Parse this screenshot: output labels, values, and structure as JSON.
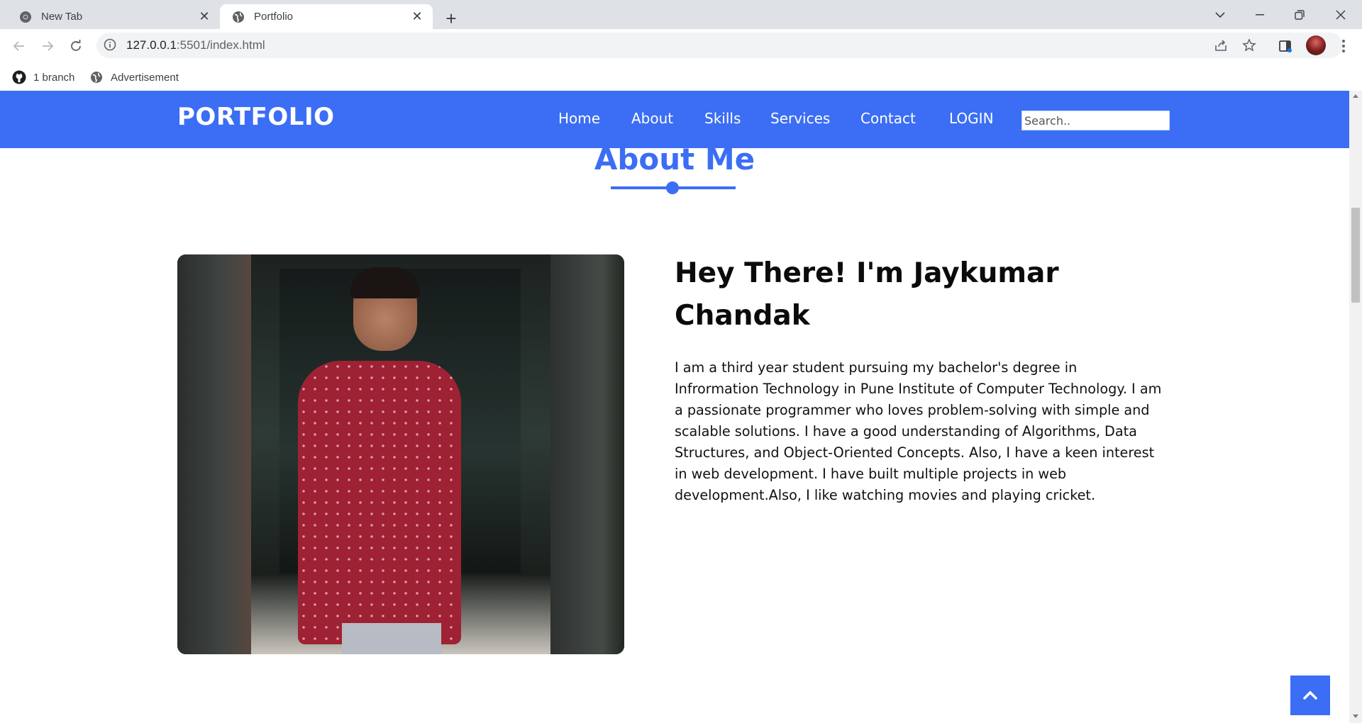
{
  "browser": {
    "tabs": [
      {
        "title": "New Tab",
        "icon": "chrome-icon",
        "active": false
      },
      {
        "title": "Portfolio",
        "icon": "globe-icon",
        "active": true
      }
    ],
    "url": {
      "host": "127.0.0.1",
      "path": ":5501/index.html"
    },
    "bookmarks": [
      {
        "label": "1 branch",
        "icon": "github-icon"
      },
      {
        "label": "Advertisement",
        "icon": "globe-icon"
      }
    ]
  },
  "site": {
    "brand": "PORTFOLIO",
    "nav": [
      "Home",
      "About",
      "Skills",
      "Services",
      "Contact",
      "LOGIN"
    ],
    "search_placeholder": "Search..",
    "accent": "#3b6ef5"
  },
  "about": {
    "section_title": "About Me",
    "heading": "Hey There! I'm Jaykumar Chandak",
    "bio": "I am a third year student pursuing my bachelor's degree in Infrormation Technology in Pune Institute of Computer Technology. I am a passionate programmer who loves problem-solving with simple and scalable solutions. I have a good understanding of Algorithms, Data Structures, and Object-Oriented Concepts. Also, I have a keen interest in web development. I have built multiple projects in web development.Also, I like watching movies and playing cricket."
  }
}
